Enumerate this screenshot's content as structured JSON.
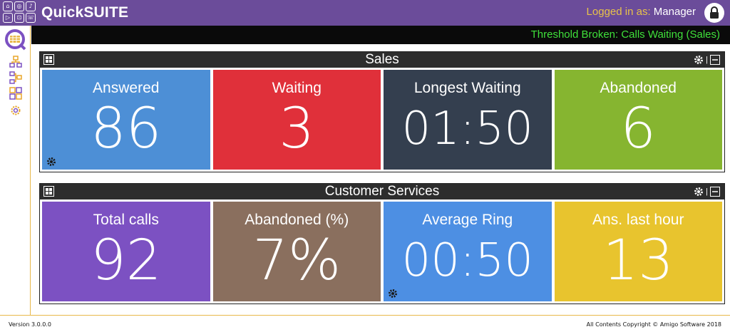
{
  "app": {
    "brand": "QuickSUITE"
  },
  "login": {
    "prefix": "Logged in as:",
    "user": "Manager"
  },
  "alert": {
    "text": "Threshold Broken: Calls Waiting (Sales)"
  },
  "colors": {
    "topbar": "#6b4c9a",
    "accent": "#e8b84a",
    "alert_text": "#3fe03a"
  },
  "panels": [
    {
      "title": "Sales",
      "tiles": [
        {
          "title": "Answered",
          "value": "86",
          "color": "#4d8fd6",
          "gear": true
        },
        {
          "title": "Waiting",
          "value": "3",
          "color": "#e0303a",
          "gear": false
        },
        {
          "title": "Longest Waiting",
          "value": "01:50",
          "color": "#343f4f",
          "gear": false
        },
        {
          "title": "Abandoned",
          "value": "6",
          "color": "#86b530",
          "gear": false
        }
      ]
    },
    {
      "title": "Customer Services",
      "tiles": [
        {
          "title": "Total calls",
          "value": "92",
          "color": "#7c51c2",
          "gear": false
        },
        {
          "title": "Abandoned (%)",
          "value": "7%",
          "color": "#8a6f5e",
          "gear": false
        },
        {
          "title": "Average Ring",
          "value": "00:50",
          "color": "#4d8fe3",
          "gear": true
        },
        {
          "title": "Ans. last hour",
          "value": "13",
          "color": "#e8c42e",
          "gear": false
        }
      ]
    }
  ],
  "footer": {
    "version": "Version 3.0.0.0",
    "copyright": "All Contents Copyright © Amigo Software 2018"
  }
}
